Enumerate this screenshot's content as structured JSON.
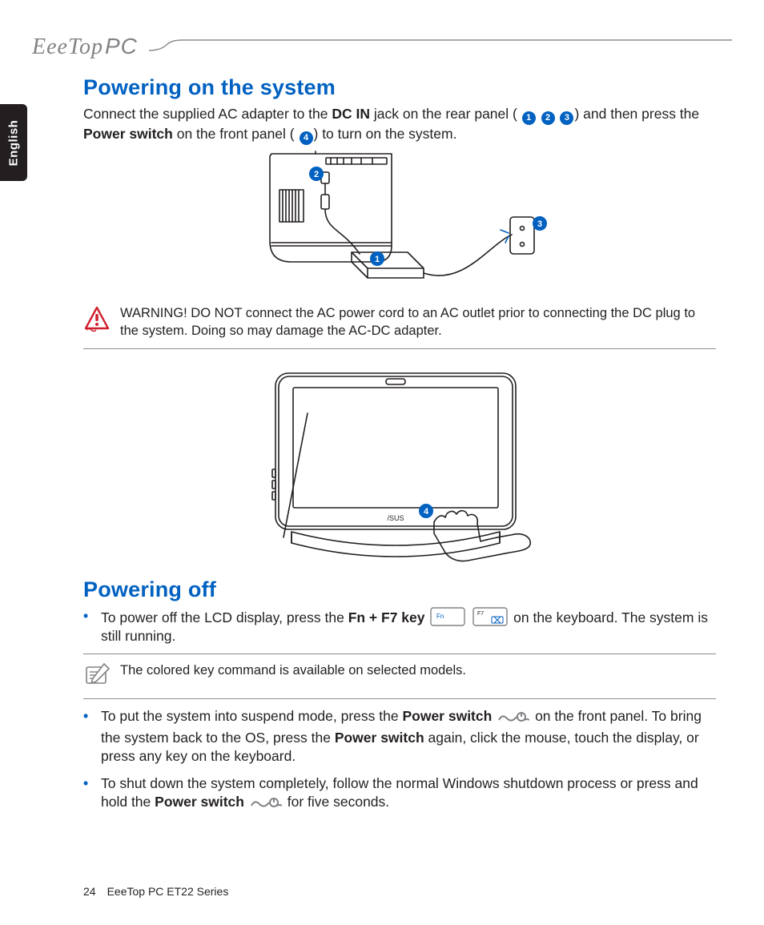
{
  "header": {
    "logo_script": "EeeTop",
    "logo_pc": "PC"
  },
  "language_tab": "English",
  "section1": {
    "heading": "Powering on the system",
    "p_a": "Connect the supplied AC adapter to the ",
    "p_b": "DC IN",
    "p_c": " jack on the rear panel (",
    "p_d": ") and then press the ",
    "p_e": "Power switch",
    "p_f": " on the front panel (",
    "p_g": ") to turn on the system.",
    "callouts_rear": [
      "1",
      "2",
      "3"
    ],
    "callout_front": "4"
  },
  "warning": {
    "text": "WARNING! DO NOT connect the AC power cord to an AC outlet prior to connecting the DC plug to the system. Doing so may damage the AC-DC adapter."
  },
  "section2": {
    "heading": "Powering off",
    "li1_a": "To power off the LCD display, press the ",
    "li1_b": "Fn + F7 key",
    "li1_c": " on the keyboard. The system is still running.",
    "key_fn": "Fn",
    "key_f7": "F7",
    "note": "The colored key command is available on selected models.",
    "li2_a": "To put the system into suspend mode, press the ",
    "li2_b": "Power switch",
    "li2_c": " on the front panel. To bring the system back to the OS, press the ",
    "li2_d": "Power switch",
    "li2_e": " again, click the mouse, touch the display, or press any key on the keyboard.",
    "li3_a": "To shut down the system completely, follow the normal Windows shutdown process or press and hold the ",
    "li3_b": "Power switch",
    "li3_c": " for five seconds."
  },
  "footer": {
    "page": "24",
    "series": "EeeTop PC ET22 Series"
  }
}
